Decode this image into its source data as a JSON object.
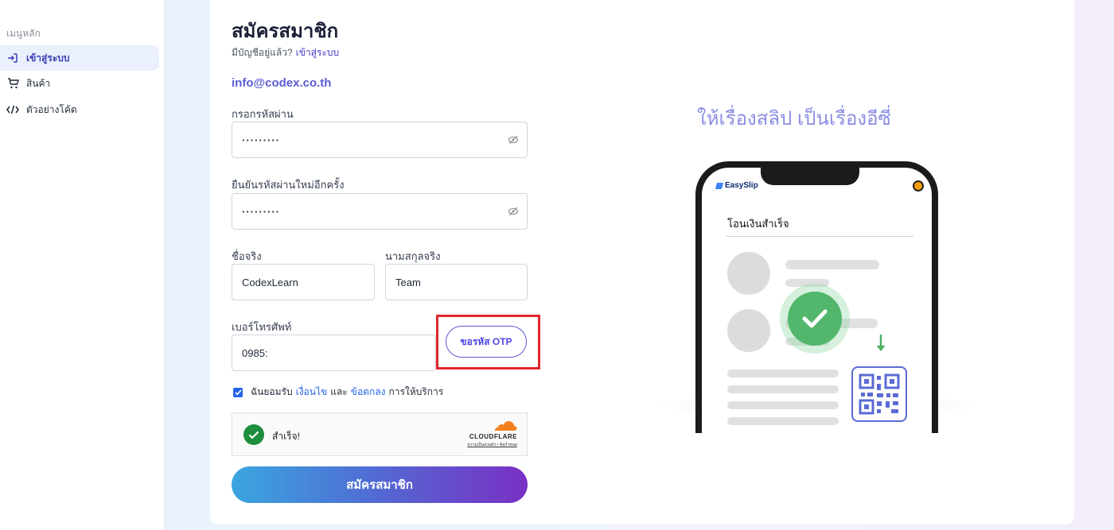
{
  "sidebar": {
    "section_label": "เมนูหลัก",
    "items": [
      {
        "label": "เข้าสู่ระบบ",
        "icon": "login-icon",
        "active": true
      },
      {
        "label": "สินค้า",
        "icon": "cart-icon",
        "active": false
      },
      {
        "label": "ตัวอย่างโค้ด",
        "icon": "code-icon",
        "active": false
      }
    ]
  },
  "form": {
    "title": "สมัครสมาชิก",
    "subtitle": "มีบัญชีอยู่แล้ว?",
    "login_link": "เข้าสู่ระบบ",
    "email": "info@codex.co.th",
    "password_label": "กรอกรหัสผ่าน",
    "password_value": "·········",
    "confirm_label": "ยืนยันรหัสผ่านใหม่อีกครั้ง",
    "confirm_value": "·········",
    "firstname_label": "ชื่อจริง",
    "firstname_value": "CodexLearn",
    "lastname_label": "นามสกุลจริง",
    "lastname_value": "Team",
    "phone_label": "เบอร์โทรศัพท์",
    "phone_value": "0985:",
    "otp_button": "ขอรหัส OTP",
    "agree_prefix": "ฉันยอมรับ",
    "agree_terms": "เงื่อนไข",
    "agree_and": "และ",
    "agree_conditions": "ข้อตกลง",
    "agree_suffix": "การให้บริการ",
    "agree_checked": true,
    "submit_label": "สมัครสมาชิก"
  },
  "captcha": {
    "status": "สำเร็จ!",
    "brand": "CLOUDFLARE",
    "links": "ความเป็นส่วนตัว • ข้อกำหนด"
  },
  "promo": {
    "headline": "ให้เรื่องสลิป เป็นเรื่องอีซี่",
    "app_name": "EasySlip",
    "screen_title": "โอนเงินสำเร็จ"
  },
  "colors": {
    "accent": "#5b5bd6",
    "highlight": "#e0262b",
    "success": "#52b66d"
  }
}
